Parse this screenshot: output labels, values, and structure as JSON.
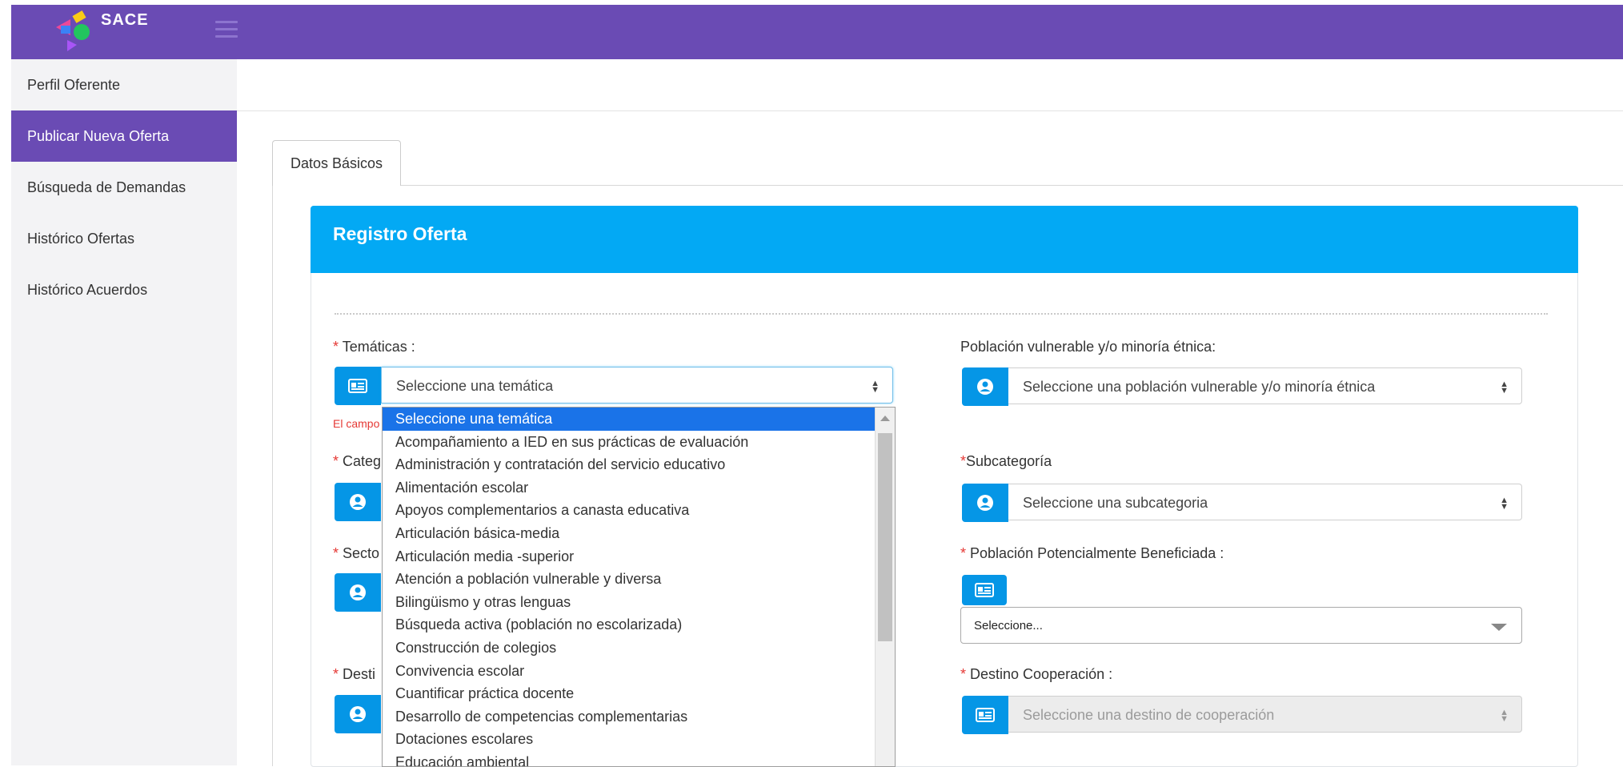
{
  "app": {
    "name": "SACE"
  },
  "colors": {
    "brand": "#6a4bb4",
    "header_blue": "#03a9f4",
    "button_blue": "#0596e6",
    "required": "#e53935",
    "selected_option": "#1a73e8"
  },
  "sidebar": {
    "items": [
      {
        "label": "Perfil Oferente",
        "active": false
      },
      {
        "label": "Publicar Nueva Oferta",
        "active": true
      },
      {
        "label": "Búsqueda de Demandas",
        "active": false
      },
      {
        "label": "Histórico Ofertas",
        "active": false
      },
      {
        "label": "Histórico Acuerdos",
        "active": false
      }
    ]
  },
  "tabs": [
    {
      "label": "Datos Básicos"
    }
  ],
  "card": {
    "title": "Registro Oferta"
  },
  "form": {
    "tematicas": {
      "required_mark": "*",
      "label": " Temáticas :",
      "value": "Seleccione una temática",
      "error": "El campo",
      "icon": "id-card-icon"
    },
    "categoria": {
      "required_mark": "*",
      "label": " Categ",
      "icon": "user-circle-icon"
    },
    "sector": {
      "required_mark": "*",
      "label": " Secto",
      "icon": "user-circle-icon"
    },
    "destino": {
      "required_mark": "*",
      "label": " Desti",
      "icon": "user-circle-icon"
    },
    "poblacion_vulnerable": {
      "label": "Población vulnerable y/o minoría étnica:",
      "value": "Seleccione una población vulnerable y/o minoría étnica",
      "icon": "user-circle-icon"
    },
    "subcategoria": {
      "required_mark": "*",
      "label": "Subcategoría",
      "value": "Seleccione una subcategoria",
      "icon": "user-circle-icon"
    },
    "poblacion_beneficiada": {
      "required_mark": "*",
      "label": " Población Potencialmente Beneficiada :",
      "value": "Seleccione...",
      "icon": "id-card-icon"
    },
    "destino_cooperacion": {
      "required_mark": "*",
      "label": " Destino Cooperación :",
      "value": "Seleccione una destino de cooperación",
      "icon": "id-card-icon",
      "disabled": true
    }
  },
  "dropdown": {
    "options": [
      "Seleccione una temática",
      "Acompañamiento a IED en sus prácticas de evaluación",
      "Administración y contratación del servicio educativo",
      "Alimentación escolar",
      "Apoyos complementarios a canasta educativa",
      "Articulación básica-media",
      "Articulación media -superior",
      "Atención a población vulnerable y diversa",
      "Bilingüismo y otras lenguas",
      "Búsqueda activa (población no escolarizada)",
      "Construcción de colegios",
      "Convivencia escolar",
      "Cuantificar práctica docente",
      "Desarrollo de competencias complementarias",
      "Dotaciones escolares",
      "Educación ambiental"
    ],
    "selected_index": 0
  }
}
